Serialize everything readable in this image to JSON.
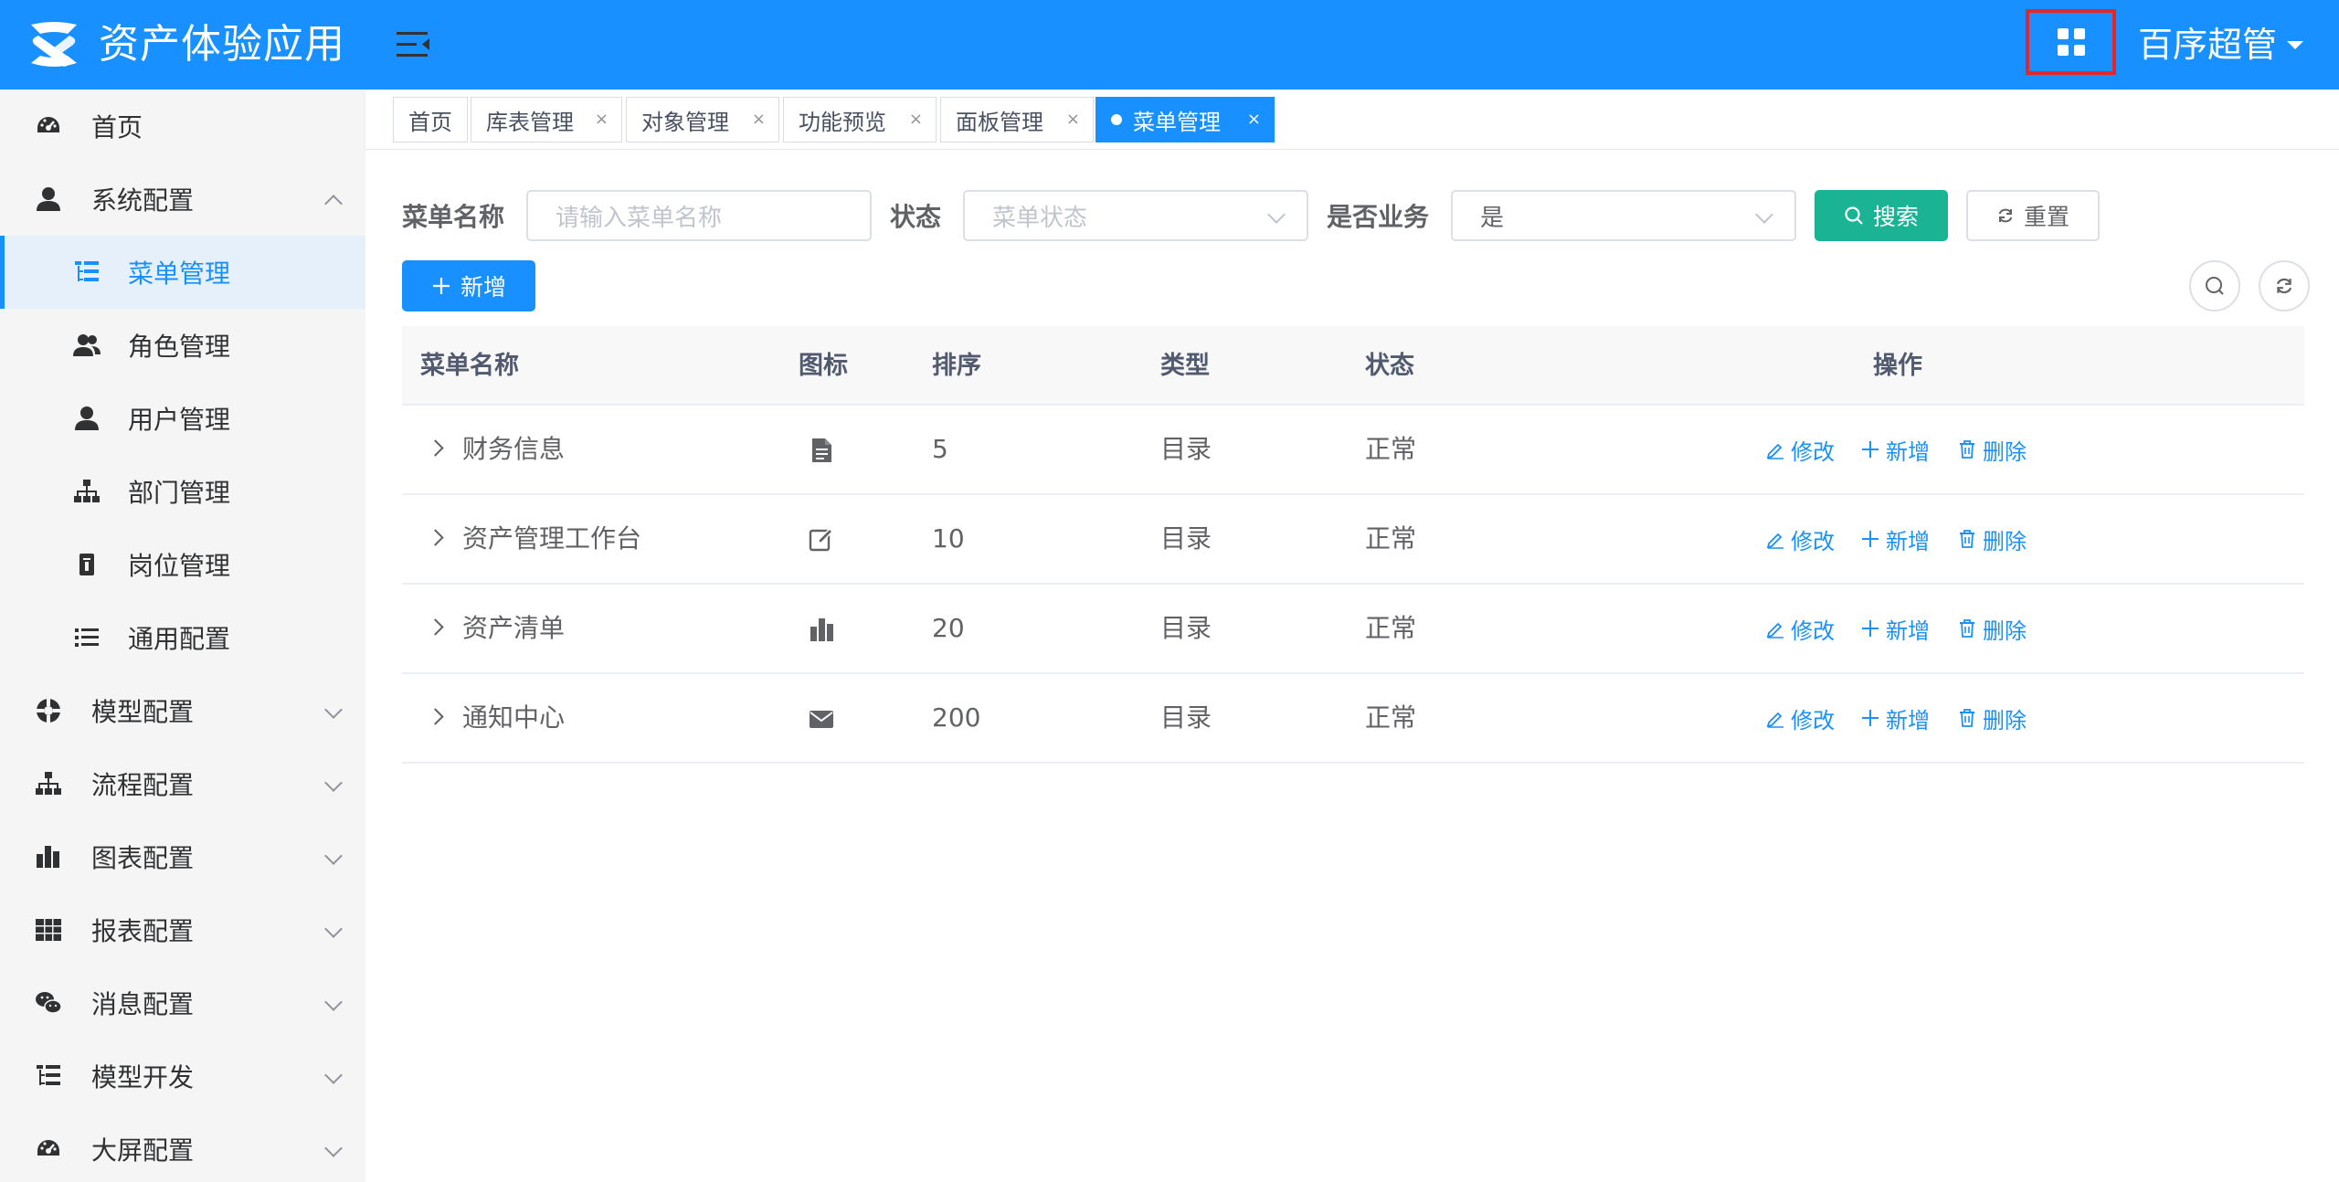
{
  "header": {
    "app_title": "资产体验应用",
    "user_name": "百序超管",
    "brand_color": "#1890ff"
  },
  "sidebar": {
    "items": [
      {
        "label": "首页",
        "icon": "dashboard-icon"
      },
      {
        "label": "系统配置",
        "icon": "user-icon",
        "expanded": true
      },
      {
        "label": "菜单管理",
        "icon": "tree-table-icon",
        "active": true
      },
      {
        "label": "角色管理",
        "icon": "peoples-icon"
      },
      {
        "label": "用户管理",
        "icon": "user-icon"
      },
      {
        "label": "部门管理",
        "icon": "tree-icon"
      },
      {
        "label": "岗位管理",
        "icon": "post-icon"
      },
      {
        "label": "通用配置",
        "icon": "list-icon"
      },
      {
        "label": "模型配置",
        "icon": "model-icon"
      },
      {
        "label": "流程配置",
        "icon": "flow-icon"
      },
      {
        "label": "图表配置",
        "icon": "chart-icon"
      },
      {
        "label": "报表配置",
        "icon": "table-icon"
      },
      {
        "label": "消息配置",
        "icon": "wechat-icon"
      },
      {
        "label": "模型开发",
        "icon": "tree-table-icon"
      },
      {
        "label": "大屏配置",
        "icon": "dashboard-icon"
      }
    ]
  },
  "tabs": [
    {
      "label": "首页"
    },
    {
      "label": "库表管理"
    },
    {
      "label": "对象管理"
    },
    {
      "label": "功能预览"
    },
    {
      "label": "面板管理"
    },
    {
      "label": "菜单管理",
      "active": true
    }
  ],
  "tab_close": "×",
  "filters": {
    "menu_name_label": "菜单名称",
    "menu_name_placeholder": "请输入菜单名称",
    "status_label": "状态",
    "status_placeholder": "菜单状态",
    "is_business_label": "是否业务",
    "is_business_value": "是",
    "search_label": "搜索",
    "reset_label": "重置"
  },
  "toolbar": {
    "add_label": "新增"
  },
  "table": {
    "columns": [
      "菜单名称",
      "图标",
      "排序",
      "类型",
      "状态",
      "操作"
    ],
    "rows": [
      {
        "name": "财务信息",
        "icon": "document-icon",
        "order": "5",
        "type": "目录",
        "status": "正常"
      },
      {
        "name": "资产管理工作台",
        "icon": "edit-icon",
        "order": "10",
        "type": "目录",
        "status": "正常"
      },
      {
        "name": "资产清单",
        "icon": "bar-chart-icon",
        "order": "20",
        "type": "目录",
        "status": "正常"
      },
      {
        "name": "通知中心",
        "icon": "mail-icon",
        "order": "200",
        "type": "目录",
        "status": "正常"
      }
    ],
    "actions": {
      "edit": "修改",
      "add": "新增",
      "delete": "删除"
    }
  },
  "colors": {
    "primary": "#1890ff",
    "success": "#1ab394",
    "highlight_border": "#e5242b"
  }
}
